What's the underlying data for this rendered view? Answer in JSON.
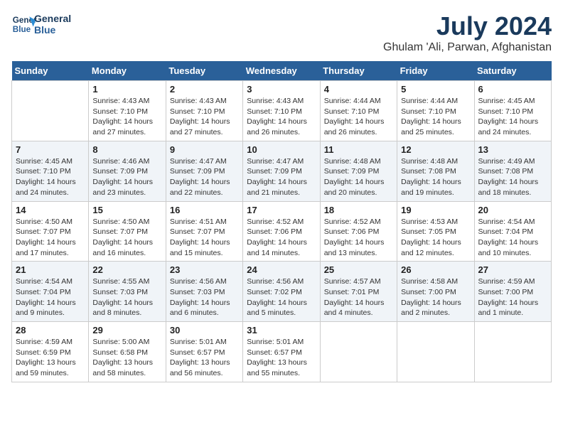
{
  "header": {
    "logo_line1": "General",
    "logo_line2": "Blue",
    "title": "July 2024",
    "subtitle": "Ghulam 'Ali, Parwan, Afghanistan"
  },
  "calendar": {
    "days_of_week": [
      "Sunday",
      "Monday",
      "Tuesday",
      "Wednesday",
      "Thursday",
      "Friday",
      "Saturday"
    ],
    "weeks": [
      [
        {
          "day": "",
          "info": ""
        },
        {
          "day": "1",
          "info": "Sunrise: 4:43 AM\nSunset: 7:10 PM\nDaylight: 14 hours\nand 27 minutes."
        },
        {
          "day": "2",
          "info": "Sunrise: 4:43 AM\nSunset: 7:10 PM\nDaylight: 14 hours\nand 27 minutes."
        },
        {
          "day": "3",
          "info": "Sunrise: 4:43 AM\nSunset: 7:10 PM\nDaylight: 14 hours\nand 26 minutes."
        },
        {
          "day": "4",
          "info": "Sunrise: 4:44 AM\nSunset: 7:10 PM\nDaylight: 14 hours\nand 26 minutes."
        },
        {
          "day": "5",
          "info": "Sunrise: 4:44 AM\nSunset: 7:10 PM\nDaylight: 14 hours\nand 25 minutes."
        },
        {
          "day": "6",
          "info": "Sunrise: 4:45 AM\nSunset: 7:10 PM\nDaylight: 14 hours\nand 24 minutes."
        }
      ],
      [
        {
          "day": "7",
          "info": "Sunrise: 4:45 AM\nSunset: 7:10 PM\nDaylight: 14 hours\nand 24 minutes."
        },
        {
          "day": "8",
          "info": "Sunrise: 4:46 AM\nSunset: 7:09 PM\nDaylight: 14 hours\nand 23 minutes."
        },
        {
          "day": "9",
          "info": "Sunrise: 4:47 AM\nSunset: 7:09 PM\nDaylight: 14 hours\nand 22 minutes."
        },
        {
          "day": "10",
          "info": "Sunrise: 4:47 AM\nSunset: 7:09 PM\nDaylight: 14 hours\nand 21 minutes."
        },
        {
          "day": "11",
          "info": "Sunrise: 4:48 AM\nSunset: 7:09 PM\nDaylight: 14 hours\nand 20 minutes."
        },
        {
          "day": "12",
          "info": "Sunrise: 4:48 AM\nSunset: 7:08 PM\nDaylight: 14 hours\nand 19 minutes."
        },
        {
          "day": "13",
          "info": "Sunrise: 4:49 AM\nSunset: 7:08 PM\nDaylight: 14 hours\nand 18 minutes."
        }
      ],
      [
        {
          "day": "14",
          "info": "Sunrise: 4:50 AM\nSunset: 7:07 PM\nDaylight: 14 hours\nand 17 minutes."
        },
        {
          "day": "15",
          "info": "Sunrise: 4:50 AM\nSunset: 7:07 PM\nDaylight: 14 hours\nand 16 minutes."
        },
        {
          "day": "16",
          "info": "Sunrise: 4:51 AM\nSunset: 7:07 PM\nDaylight: 14 hours\nand 15 minutes."
        },
        {
          "day": "17",
          "info": "Sunrise: 4:52 AM\nSunset: 7:06 PM\nDaylight: 14 hours\nand 14 minutes."
        },
        {
          "day": "18",
          "info": "Sunrise: 4:52 AM\nSunset: 7:06 PM\nDaylight: 14 hours\nand 13 minutes."
        },
        {
          "day": "19",
          "info": "Sunrise: 4:53 AM\nSunset: 7:05 PM\nDaylight: 14 hours\nand 12 minutes."
        },
        {
          "day": "20",
          "info": "Sunrise: 4:54 AM\nSunset: 7:04 PM\nDaylight: 14 hours\nand 10 minutes."
        }
      ],
      [
        {
          "day": "21",
          "info": "Sunrise: 4:54 AM\nSunset: 7:04 PM\nDaylight: 14 hours\nand 9 minutes."
        },
        {
          "day": "22",
          "info": "Sunrise: 4:55 AM\nSunset: 7:03 PM\nDaylight: 14 hours\nand 8 minutes."
        },
        {
          "day": "23",
          "info": "Sunrise: 4:56 AM\nSunset: 7:03 PM\nDaylight: 14 hours\nand 6 minutes."
        },
        {
          "day": "24",
          "info": "Sunrise: 4:56 AM\nSunset: 7:02 PM\nDaylight: 14 hours\nand 5 minutes."
        },
        {
          "day": "25",
          "info": "Sunrise: 4:57 AM\nSunset: 7:01 PM\nDaylight: 14 hours\nand 4 minutes."
        },
        {
          "day": "26",
          "info": "Sunrise: 4:58 AM\nSunset: 7:00 PM\nDaylight: 14 hours\nand 2 minutes."
        },
        {
          "day": "27",
          "info": "Sunrise: 4:59 AM\nSunset: 7:00 PM\nDaylight: 14 hours\nand 1 minute."
        }
      ],
      [
        {
          "day": "28",
          "info": "Sunrise: 4:59 AM\nSunset: 6:59 PM\nDaylight: 13 hours\nand 59 minutes."
        },
        {
          "day": "29",
          "info": "Sunrise: 5:00 AM\nSunset: 6:58 PM\nDaylight: 13 hours\nand 58 minutes."
        },
        {
          "day": "30",
          "info": "Sunrise: 5:01 AM\nSunset: 6:57 PM\nDaylight: 13 hours\nand 56 minutes."
        },
        {
          "day": "31",
          "info": "Sunrise: 5:01 AM\nSunset: 6:57 PM\nDaylight: 13 hours\nand 55 minutes."
        },
        {
          "day": "",
          "info": ""
        },
        {
          "day": "",
          "info": ""
        },
        {
          "day": "",
          "info": ""
        }
      ]
    ]
  }
}
